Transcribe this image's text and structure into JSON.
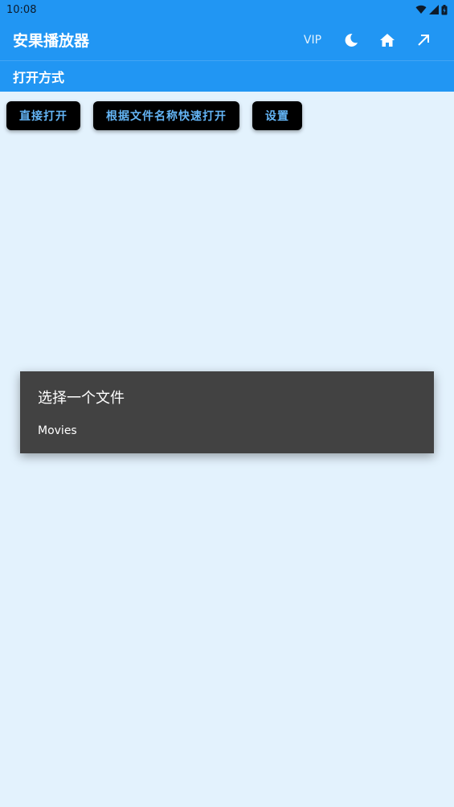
{
  "status_bar": {
    "time": "10:08"
  },
  "app_bar": {
    "title": "安果播放器",
    "vip_label": "VIP"
  },
  "sub_bar": {
    "title": "打开方式"
  },
  "buttons": {
    "direct_open": "直接打开",
    "quick_open_by_name": "根据文件名称快速打开",
    "settings": "设置"
  },
  "dialog": {
    "title": "选择一个文件",
    "items": [
      "Movies"
    ]
  },
  "colors": {
    "primary": "#2196F3",
    "background": "#E3F2FD",
    "button_bg": "#000000",
    "button_text": "#64B5F6",
    "dialog_bg": "#424242"
  },
  "icons": [
    "wifi-icon",
    "cell-signal-icon",
    "battery-icon",
    "moon-icon",
    "home-icon",
    "arrow-up-right-icon"
  ]
}
